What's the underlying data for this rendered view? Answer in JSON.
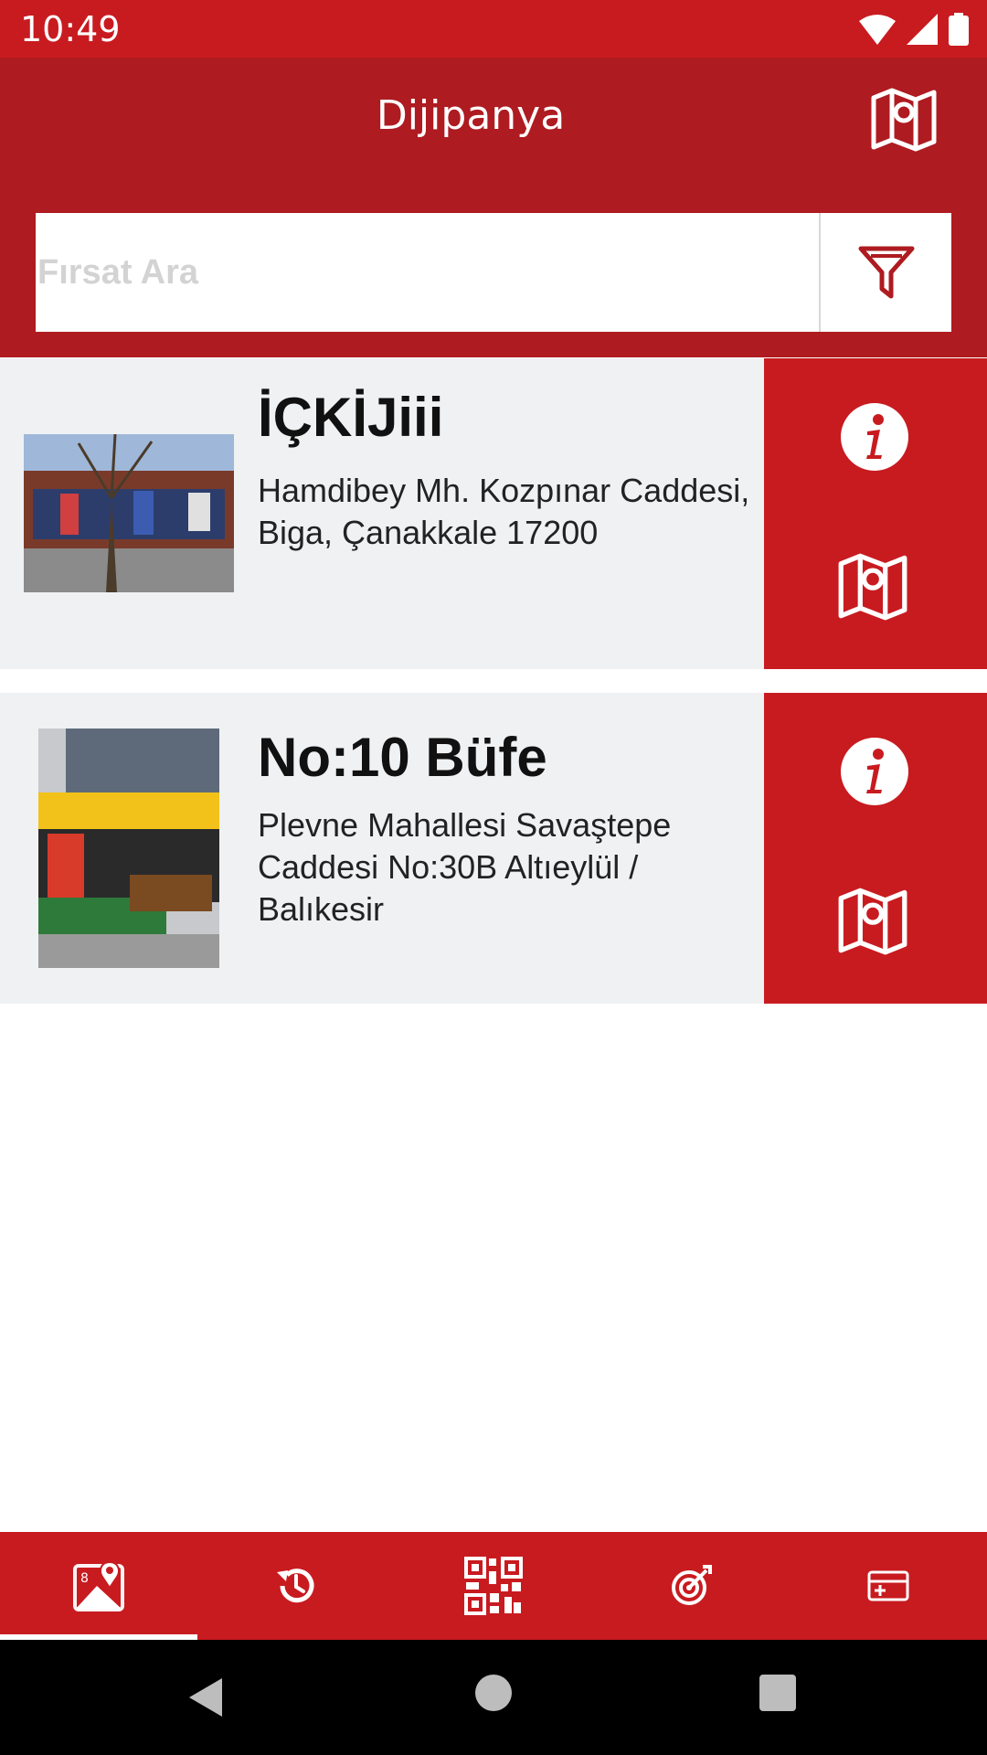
{
  "status_bar": {
    "time": "10:49"
  },
  "app_bar": {
    "title": "Dijipanya"
  },
  "search": {
    "placeholder": "Fırsat Ara",
    "value": ""
  },
  "places": [
    {
      "title": "İÇKİJiii",
      "address": "Hamdibey Mh. Kozpınar Caddesi, Biga, Çanakkale 17200"
    },
    {
      "title": "No:10 Büfe",
      "address": "Plevne Mahallesi Savaştepe Caddesi  No:30B Altıeylül / Balıkesir"
    }
  ],
  "bottom_nav": {
    "tabs": [
      "map-pin-tab",
      "history-tab",
      "qr-code-tab",
      "target-tab",
      "card-tab"
    ],
    "active_index": 0
  },
  "colors": {
    "primary": "#c81b20",
    "primary_dark": "#ae1b20",
    "list_bg": "#f0f1f3"
  }
}
